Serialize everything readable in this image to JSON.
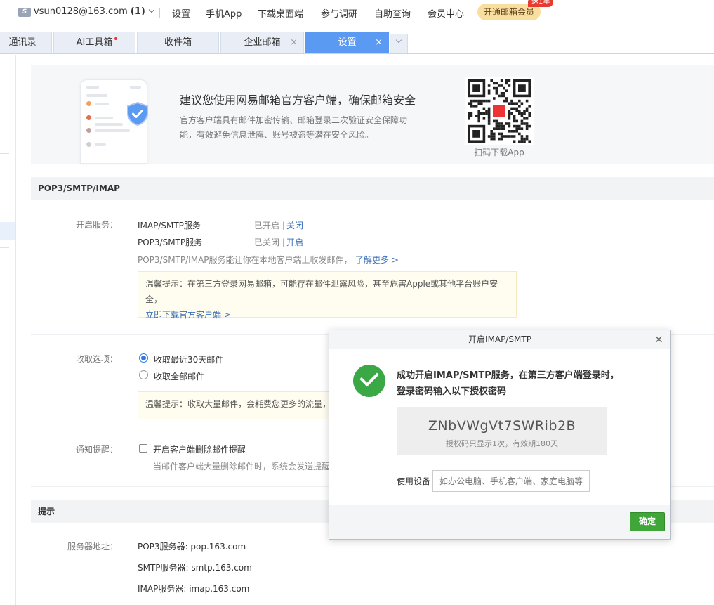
{
  "topbar": {
    "account_email": "vsun0128@163.com",
    "account_count": "(1)",
    "links": [
      "设置",
      "手机App",
      "下载桌面端",
      "参与调研",
      "自助查询",
      "会员中心"
    ],
    "vip_button": "开通邮箱会员",
    "vip_badge": "送1年",
    "logo_letter": "S"
  },
  "tabs": [
    {
      "label": "通讯录",
      "active": false,
      "closable": false
    },
    {
      "label": "AI工具箱",
      "active": false,
      "closable": false,
      "dot": true
    },
    {
      "label": "收件箱",
      "active": false,
      "closable": false
    },
    {
      "label": "企业邮箱",
      "active": false,
      "closable": true
    },
    {
      "label": "设置",
      "active": true,
      "closable": true
    }
  ],
  "banner": {
    "title": "建议您使用网易邮箱官方客户端，确保邮箱安全",
    "text": "官方客户端具有邮件加密传输、邮箱登录二次验证安全保障功能，有效避免信息泄露、账号被盗等潜在安全风险。",
    "qr_caption": "扫码下载App"
  },
  "pop3_section": {
    "title": "POP3/SMTP/IMAP",
    "service_label": "开启服务：",
    "services": [
      {
        "name": "IMAP/SMTP服务",
        "status": "已开启",
        "action": "关闭"
      },
      {
        "name": "POP3/SMTP服务",
        "status": "已关闭",
        "action": "开启"
      }
    ],
    "description": "POP3/SMTP/IMAP服务能让你在本地客户端上收发邮件，",
    "learn_more": "了解更多 >",
    "notice_text": "温馨提示：在第三方登录网易邮箱，可能存在邮件泄露风险，甚至危害Apple或其他平台账户安全，",
    "notice_link": "立即下载官方客户端 >",
    "receive_label": "收取选项：",
    "receive_options": [
      "收取最近30天邮件",
      "收取全部邮件"
    ],
    "receive_notice": "温馨提示：收取大量邮件，会耗费您更多的流量，",
    "notify_label": "通知提醒：",
    "notify_option": "开启客户端删除邮件提醒",
    "notify_desc": "当邮件客户端大量删除邮件时，系统会发送提醒"
  },
  "tips_section": {
    "title": "提示",
    "server_label": "服务器地址：",
    "servers": [
      "POP3服务器: pop.163.com",
      "SMTP服务器: smtp.163.com",
      "IMAP服务器: imap.163.com"
    ]
  },
  "modal": {
    "title": "开启IMAP/SMTP",
    "close": "×",
    "message": "成功开启IMAP/SMTP服务，在第三方客户端登录时，登录密码输入以下授权密码",
    "auth_code": "ZNbVWgVt7SWRib2B",
    "auth_note": "授权码只显示1次，有效期180天",
    "device_label": "使用设备",
    "device_placeholder": "如办公电脑、手机客户端、家庭电脑等",
    "ok_button": "确定"
  },
  "colors": {
    "accent_blue": "#5b9af3",
    "link_blue": "#3a6fb8",
    "success_green": "#3aa844",
    "ok_button": "#41a63a",
    "vip_gold": "#f8dfa0"
  }
}
